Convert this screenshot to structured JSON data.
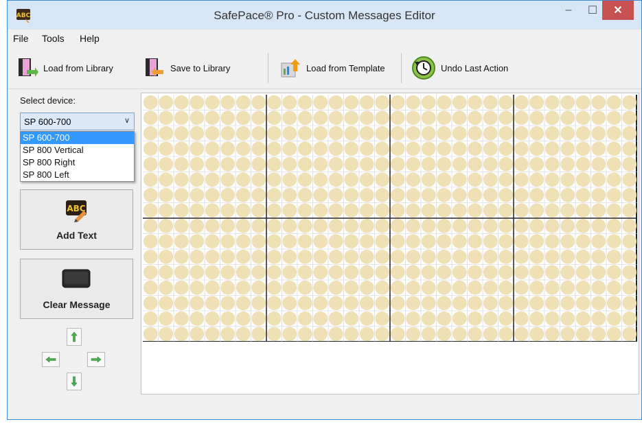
{
  "window": {
    "title": "SafePace® Pro - Custom Messages Editor",
    "minimize_glyph": "–",
    "maximize_glyph": "☐",
    "close_glyph": "✕",
    "app_icon": "abc-icon",
    "colors": {
      "accent": "#3f8bd6",
      "close": "#c75050",
      "selected": "#3399ff",
      "led": "#efe0b6"
    }
  },
  "menu": [
    "File",
    "Tools",
    "Help"
  ],
  "toolbar": {
    "load_library": "Load from Library",
    "save_library": "Save to Library",
    "load_template": "Load from Template",
    "undo": "Undo Last Action"
  },
  "device": {
    "label": "Select device:",
    "selected": "SP 600-700",
    "options": [
      "SP 600-700",
      "SP 800 Vertical",
      "SP 800 Right",
      "SP 800 Left"
    ]
  },
  "actions": {
    "add_text": "Add Text",
    "clear_message": "Clear Message"
  },
  "led_grid": {
    "rows": 16,
    "cols": 32,
    "panel_rows": 2,
    "panel_cols": 4
  }
}
